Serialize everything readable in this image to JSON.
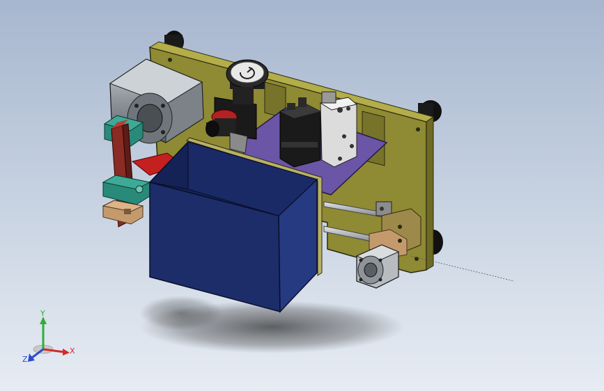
{
  "triad": {
    "y_label": "Y",
    "x_label": "X",
    "z_label": "Z"
  },
  "colors": {
    "background_top": "#a7b6cf",
    "background_bottom": "#e7ecf3",
    "base_plate": "#8f8a34",
    "enclosure_box": "#1d2d6a",
    "purple_plate": "#6a55a6",
    "teal_clamp": "#2a8a7a",
    "red_block": "#8a2b24",
    "cylinder_gray": "#9aa0a6",
    "axis_x": "#d12b2b",
    "axis_y": "#2fae3a",
    "axis_z": "#2b4bd1"
  }
}
